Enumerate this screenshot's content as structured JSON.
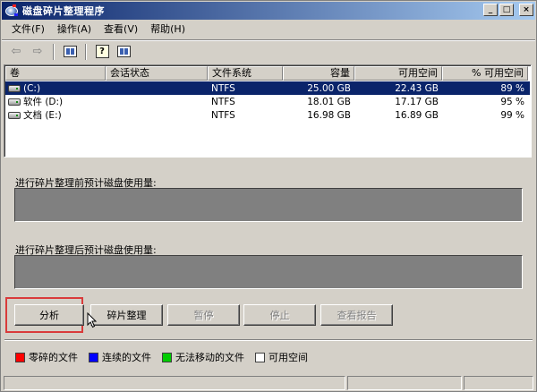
{
  "window": {
    "title": "磁盘碎片整理程序",
    "controls": {
      "minimize": "_",
      "maximize": "□",
      "close": "×"
    }
  },
  "menubar": {
    "items": [
      {
        "label": "文件(F)"
      },
      {
        "label": "操作(A)"
      },
      {
        "label": "查看(V)"
      },
      {
        "label": "帮助(H)"
      }
    ]
  },
  "toolbar": {
    "back_icon": "arrow-left-icon",
    "forward_icon": "arrow-right-icon",
    "back_glyph": "⇦",
    "forward_glyph": "⇨",
    "help_glyph": "?"
  },
  "volumes": {
    "headers": {
      "volume": "卷",
      "session_status": "会话状态",
      "file_system": "文件系统",
      "capacity": "容量",
      "free_space": "可用空间",
      "pct_free": "% 可用空间"
    },
    "rows": [
      {
        "volume": "(C:)",
        "session_status": "",
        "file_system": "NTFS",
        "capacity": "25.00 GB",
        "free_space": "22.43 GB",
        "pct_free": "89 %",
        "selected": true
      },
      {
        "volume": "软件 (D:)",
        "session_status": "",
        "file_system": "NTFS",
        "capacity": "18.01 GB",
        "free_space": "17.17 GB",
        "pct_free": "95 %",
        "selected": false
      },
      {
        "volume": "文档 (E:)",
        "session_status": "",
        "file_system": "NTFS",
        "capacity": "16.98 GB",
        "free_space": "16.89 GB",
        "pct_free": "99 %",
        "selected": false
      }
    ]
  },
  "analysis": {
    "before_label": "进行碎片整理前预计磁盘使用量:",
    "after_label": "进行碎片整理后预计磁盘使用量:"
  },
  "actions": {
    "analyze": "分析",
    "defragment": "碎片整理",
    "pause": "暂停",
    "stop": "停止",
    "view_report": "查看报告"
  },
  "legend": {
    "items": [
      {
        "label": "零碎的文件",
        "color": "#ff0000"
      },
      {
        "label": "连续的文件",
        "color": "#0000ff"
      },
      {
        "label": "无法移动的文件",
        "color": "#00cc00"
      },
      {
        "label": "可用空间",
        "color": "#ffffff"
      }
    ]
  },
  "colors": {
    "title_bar_start": "#0a246a",
    "title_bar_end": "#a6caf0",
    "selection": "#0a246a",
    "highlight_frame": "#d93b3b",
    "usage_bar_empty": "#808080"
  }
}
